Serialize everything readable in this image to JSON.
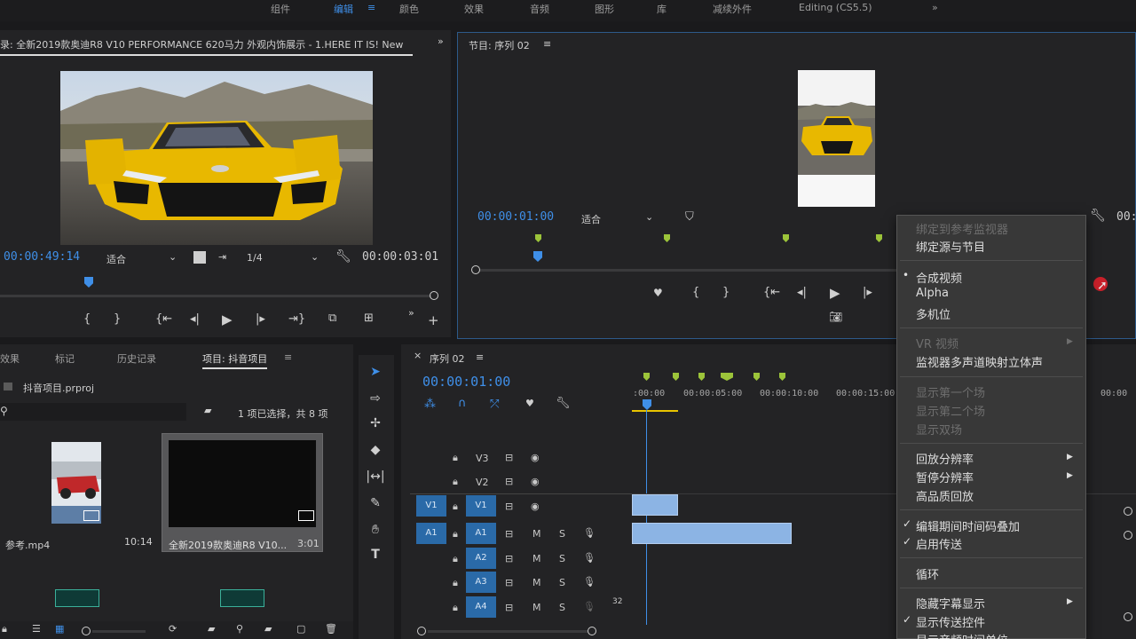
{
  "workspaces": [
    "组件",
    "编辑",
    "颜色",
    "效果",
    "音频",
    "图形",
    "库",
    "减续外件",
    "Editing (CS5.5)",
    "»"
  ],
  "source_monitor": {
    "title": "录: 全新2019款奥迪R8 V10 PERFORMANCE 620马力 外观内饰展示 - 1.HERE IT IS! New",
    "overflow": "»",
    "timecode": "00:00:49:14",
    "fit": "适合",
    "ratio": "1/4",
    "duration": "00:00:03:01"
  },
  "program_monitor": {
    "title": "节目: 序列 02",
    "menu_icon": "≡",
    "timecode": "00:00:01:00",
    "fit": "适合",
    "right_timecode": "00:"
  },
  "project_panel": {
    "tabs": [
      "效果",
      "标记",
      "历史记录",
      "项目: 抖音项目"
    ],
    "menu_icon": "≡",
    "file": "抖音项目.prproj",
    "selection_info": "1 项已选择，共 8 项",
    "items": [
      {
        "name": "参考.mp4",
        "duration": "10:14"
      },
      {
        "name": "全新2019款奥迪R8 V10...",
        "duration": "3:01"
      }
    ]
  },
  "timeline": {
    "title": "序列 02",
    "menu_icon": "≡",
    "timecode": "00:00:01:00",
    "ruler": [
      ":00:00",
      "00:00:05:00",
      "00:00:10:00",
      "00:00:15:00",
      "00:00"
    ],
    "tracks": [
      {
        "label": "V3",
        "kind": "video"
      },
      {
        "label": "V2",
        "kind": "video"
      },
      {
        "label": "V1",
        "kind": "video",
        "source": "V1"
      },
      {
        "label": "A1",
        "kind": "audio",
        "source": "A1"
      },
      {
        "label": "A2",
        "kind": "audio"
      },
      {
        "label": "A3",
        "kind": "audio"
      },
      {
        "label": "A4",
        "kind": "audio"
      }
    ],
    "mute": "M",
    "solo": "S",
    "level": "32"
  },
  "context_menu": {
    "items": [
      {
        "label": "绑定到参考监视器",
        "disabled": true
      },
      {
        "label": "绑定源与节目",
        "disabled": false
      },
      {
        "label": "合成视频",
        "mark": "•"
      },
      {
        "label": "Alpha"
      },
      {
        "label": "多机位"
      },
      {
        "label": "VR 视频",
        "disabled": true,
        "submenu": true
      },
      {
        "label": "监视器多声道映射立体声"
      },
      {
        "label": "显示第一个场",
        "disabled": true
      },
      {
        "label": "显示第二个场",
        "disabled": true
      },
      {
        "label": "显示双场",
        "disabled": true
      },
      {
        "label": "回放分辨率",
        "submenu": true
      },
      {
        "label": "暂停分辨率",
        "submenu": true
      },
      {
        "label": "高品质回放"
      },
      {
        "label": "编辑期间时间码叠加",
        "mark": "✓"
      },
      {
        "label": "启用传送",
        "mark": "✓"
      },
      {
        "label": "循环"
      },
      {
        "label": "隐藏字幕显示",
        "submenu": true
      },
      {
        "label": "显示传送控件",
        "mark": "✓"
      },
      {
        "label": "显示音频时间单位"
      }
    ]
  },
  "colors": {
    "accent": "#3f8fe8",
    "marker": "#9cc43a",
    "clip": "#8cb4e4",
    "track_button": "#2a6aa8",
    "car_yellow": "#e8b800"
  }
}
